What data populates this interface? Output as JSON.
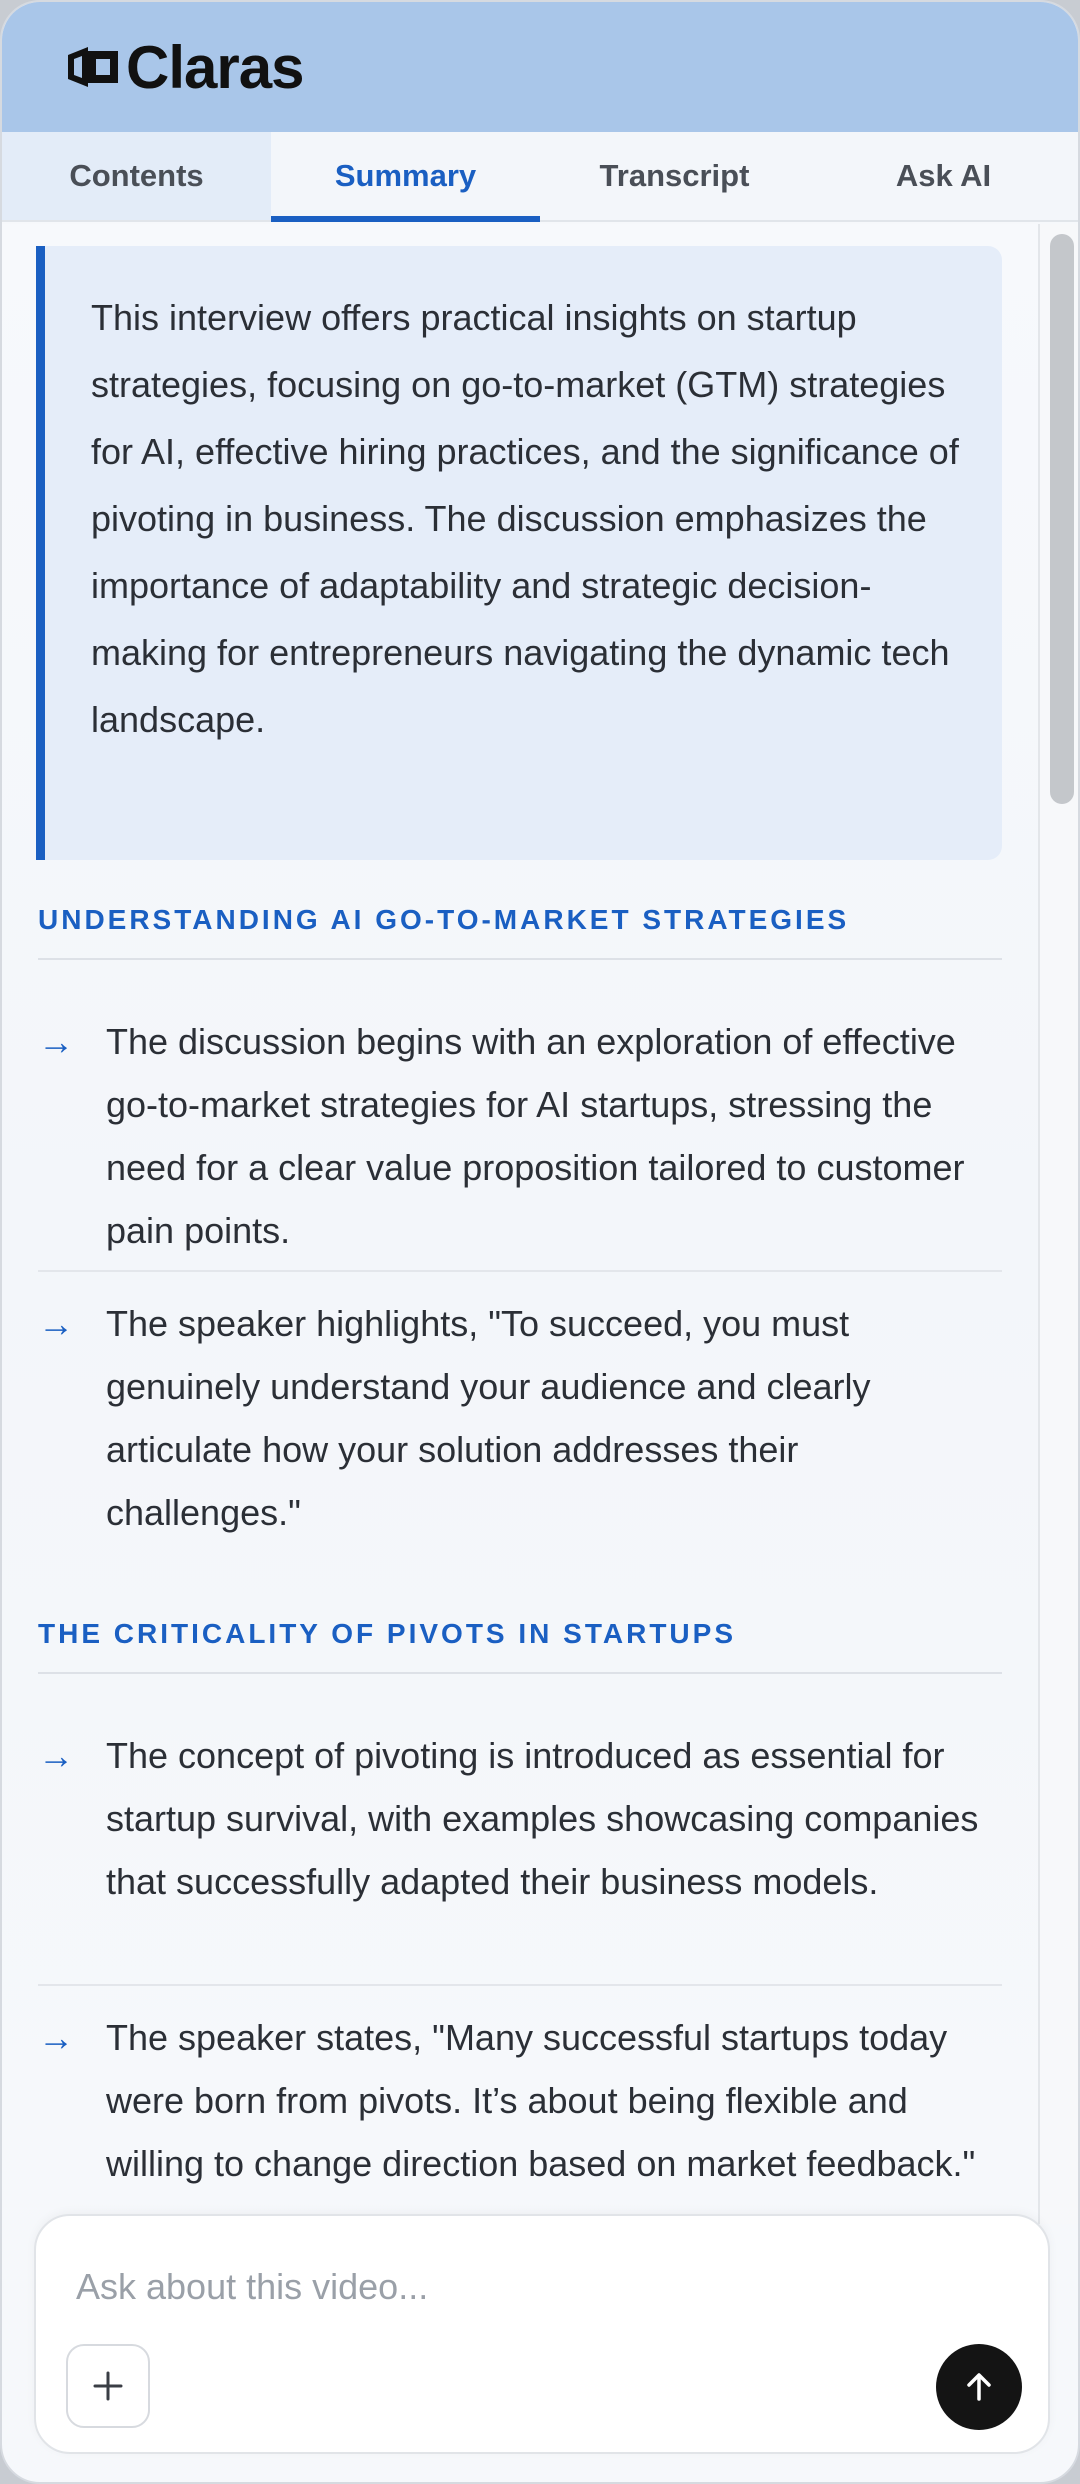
{
  "app": {
    "brand": "Claras"
  },
  "tabs": [
    {
      "label": "Contents"
    },
    {
      "label": "Summary"
    },
    {
      "label": "Transcript"
    },
    {
      "label": "Ask AI"
    }
  ],
  "active_tab": "Summary",
  "summary": {
    "intro": "This interview offers practical insights on startup strategies, focusing on go-to-market (GTM) strategies for AI, effective hiring practices, and the significance of pivoting in business. The discussion emphasizes the importance of adaptability and strategic decision-making for entrepreneurs navigating the dynamic tech landscape."
  },
  "sections": [
    {
      "title": "UNDERSTANDING AI GO-TO-MARKET STRATEGIES",
      "bullets": [
        "The discussion begins with an exploration of effective go-to-market strategies for AI startups, stressing the need for a clear value proposition tailored to customer pain points.",
        "The speaker highlights, \"To succeed, you must genuinely understand your audience and clearly articulate how your solution addresses their challenges.\""
      ]
    },
    {
      "title": "THE CRITICALITY OF PIVOTS IN STARTUPS",
      "bullets": [
        "The concept of pivoting is introduced as essential for startup survival, with examples showcasing companies that successfully adapted their business models.",
        "The speaker states, \"Many successful startups today were born from pivots. It’s about being flexible and willing to change direction based on market feedback.\""
      ]
    }
  ],
  "ask": {
    "placeholder": "Ask about this video...",
    "value": ""
  },
  "icons": {
    "logo": "claras-logo-icon",
    "bullet": "arrow-right-icon",
    "attach": "plus-icon",
    "send": "arrow-up-icon"
  },
  "colors": {
    "header_bg": "#a9c6e9",
    "accent": "#1a5fc2",
    "summary_bg": "#e5edf9",
    "send_bg": "#141414"
  }
}
